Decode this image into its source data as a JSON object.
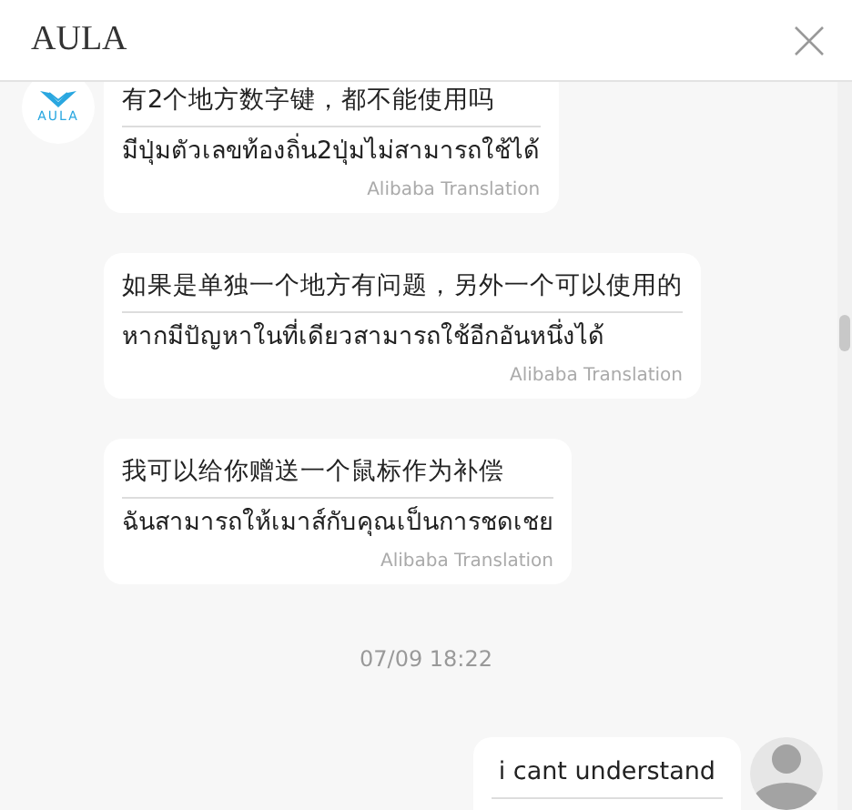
{
  "window": {
    "title": "AULA"
  },
  "messages": [
    {
      "kind": "received",
      "avatar": "AULA",
      "text": "有2个地方数字键，都不能使用吗",
      "translation": "มีปุ่มตัวเลขท้องถิ่น2ปุ่มไม่สามารถใช้ได้",
      "credit": "Alibaba Translation"
    },
    {
      "kind": "received",
      "text": "如果是单独一个地方有问题，另外一个可以使用的",
      "translation": "หากมีปัญหาในที่เดียวสามารถใช้อีกอันหนึ่งได้",
      "credit": "Alibaba Translation"
    },
    {
      "kind": "received",
      "text": "我可以给你赠送一个鼠标作为补偿",
      "translation": "ฉันสามารถให้เมาส์กับคุณเป็นการชดเชย",
      "credit": "Alibaba Translation"
    },
    {
      "kind": "time",
      "text": "07/09 18:22"
    },
    {
      "kind": "sent",
      "text": "i cant understand"
    }
  ]
}
